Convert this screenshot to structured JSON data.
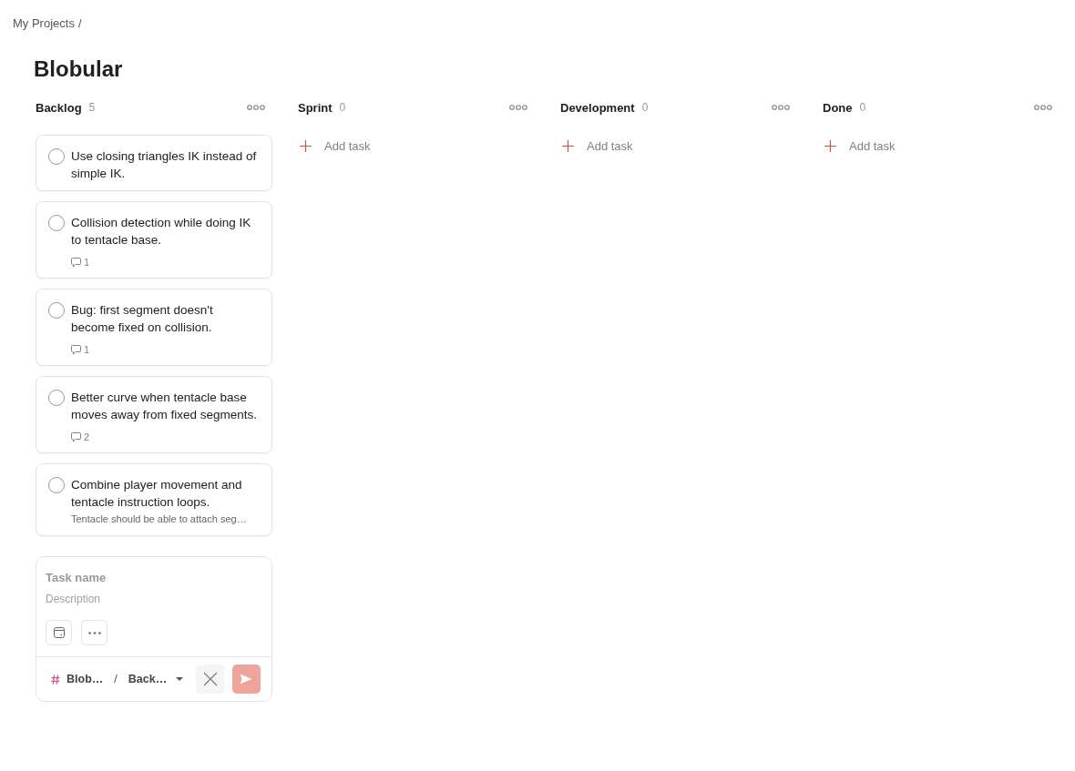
{
  "breadcrumb": {
    "label": "My Projects",
    "separator": "/"
  },
  "title": "Blobular",
  "columns": [
    {
      "name": "Backlog",
      "count": "5",
      "tasks": [
        {
          "title": "Use closing triangles IK instead of simple IK.",
          "completed": false
        },
        {
          "title": "Collision detection while doing IK to tentacle base.",
          "completed": false,
          "comments": "1"
        },
        {
          "title": "Bug: first segment doesn't become fixed on collision.",
          "completed": false,
          "comments": "1"
        },
        {
          "title": "Better curve when tentacle base moves away from fixed segments.",
          "completed": false,
          "comments": "2"
        },
        {
          "title": "Combine player movement and tentacle instruction loops.",
          "completed": false,
          "description": "Tentacle should be able to attach seg…"
        }
      ],
      "quick_add": {
        "task_name_placeholder": "Task name",
        "description_placeholder": "Description",
        "project": "Blob…",
        "separator": "/",
        "section": "Back…",
        "submit_enabled": false
      }
    },
    {
      "name": "Sprint",
      "count": "0",
      "add_task": "Add task"
    },
    {
      "name": "Development",
      "count": "0",
      "add_task": "Add task"
    },
    {
      "name": "Done",
      "count": "0",
      "add_task": "Add task"
    }
  ]
}
